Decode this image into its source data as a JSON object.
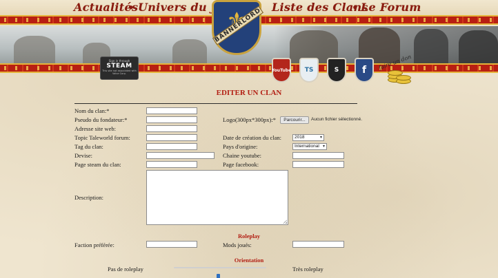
{
  "nav": {
    "items": [
      {
        "label": "Actualités"
      },
      {
        "label": "Univers du Jeu"
      },
      {
        "label": "Liste des Clans"
      },
      {
        "label": "Le Forum"
      }
    ],
    "separator": "•"
  },
  "logo": {
    "text": "BANNERLORD"
  },
  "steam_badge": {
    "line1": "Sign in through",
    "line2": "STEAM",
    "line3": "This site not associated with Valve Corp."
  },
  "social": [
    {
      "name": "youtube",
      "label": "YouTube",
      "color": "#b3261c"
    },
    {
      "name": "teamspeak",
      "label": "TS",
      "color": "#e8eef2"
    },
    {
      "name": "steam",
      "label": "S",
      "color": "#222222"
    },
    {
      "name": "facebook",
      "label": "f",
      "color": "#2a4a86"
    }
  ],
  "donate": {
    "label": "faire un don"
  },
  "form": {
    "title": "EDITER UN CLAN",
    "fields": {
      "nom_clan": {
        "label": "Nom du clan:*",
        "value": ""
      },
      "pseudo": {
        "label": "Pseudo du fondateur:*",
        "value": ""
      },
      "site": {
        "label": "Adresse site web:",
        "value": ""
      },
      "topic": {
        "label": "Topic Taleworld forum:",
        "value": ""
      },
      "tag": {
        "label": "Tag du clan:",
        "value": ""
      },
      "devise": {
        "label": "Devise:",
        "value": ""
      },
      "steam_page": {
        "label": "Page steam du clan:",
        "value": ""
      },
      "description": {
        "label": "Description:",
        "value": ""
      },
      "logo": {
        "label": "Logo(300px*300px):*",
        "button": "Parcourir...",
        "status": "Aucun fichier sélectionné."
      },
      "date_creation": {
        "label": "Date de création du clan:",
        "value": "2018"
      },
      "pays": {
        "label": "Pays d'origine:",
        "value": "International"
      },
      "youtube": {
        "label": "Chaine youtube:",
        "value": ""
      },
      "facebook": {
        "label": "Page facebook:",
        "value": ""
      }
    },
    "roleplay": {
      "title": "Roleplay",
      "faction": {
        "label": "Faction préférée:",
        "value": ""
      },
      "mods": {
        "label": "Mods joués:",
        "value": ""
      }
    },
    "orientation": {
      "title": "Orientation",
      "left_label": "Pas de roleplay",
      "right_label": "Très roleplay",
      "value": 0.5
    }
  }
}
